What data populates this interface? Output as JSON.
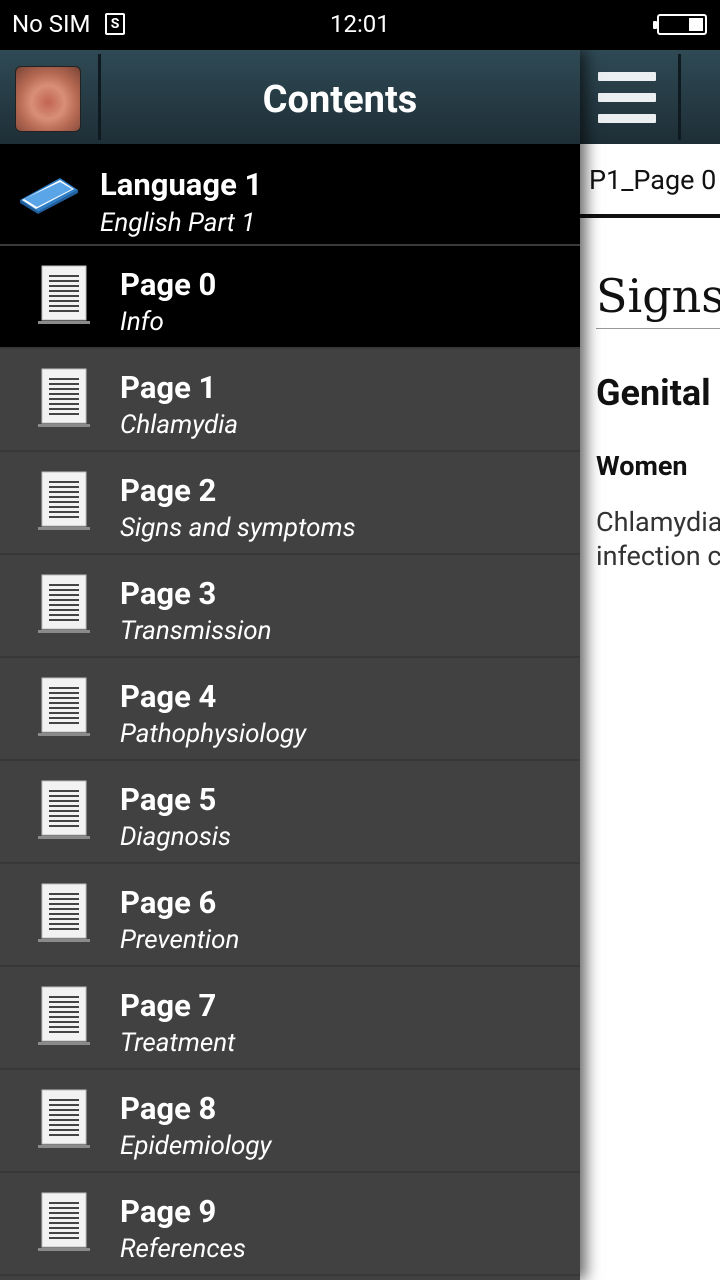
{
  "status_bar": {
    "carrier": "No SIM",
    "sim_glyph": "S",
    "time": "12:01"
  },
  "drawer": {
    "title": "Contents",
    "language": {
      "title": "Language 1",
      "subtitle": "English Part 1"
    },
    "items": [
      {
        "title": "Page 0",
        "subtitle": "Info"
      },
      {
        "title": "Page 1",
        "subtitle": "Chlamydia"
      },
      {
        "title": "Page 2",
        "subtitle": "Signs and symptoms"
      },
      {
        "title": "Page 3",
        "subtitle": "Transmission"
      },
      {
        "title": "Page 4",
        "subtitle": "Pathophysiology"
      },
      {
        "title": "Page 5",
        "subtitle": "Diagnosis"
      },
      {
        "title": "Page 6",
        "subtitle": "Prevention"
      },
      {
        "title": "Page 7",
        "subtitle": "Treatment"
      },
      {
        "title": "Page 8",
        "subtitle": "Epidemiology"
      },
      {
        "title": "Page 9",
        "subtitle": "References"
      }
    ]
  },
  "content": {
    "tab_label": "P1_Page 0",
    "article_title": "Signs",
    "section_heading": "Genital",
    "subsection_heading": "Women",
    "body_lines": [
      "Chlamydia",
      "infection c"
    ]
  },
  "colors": {
    "header_bg": "#26404a",
    "drawer_bg": "#414141",
    "selected_bg": "#000000"
  },
  "icons": {
    "menu": "hamburger-menu-icon",
    "language": "book-icon",
    "page": "document-icon",
    "app": "app-logo"
  }
}
